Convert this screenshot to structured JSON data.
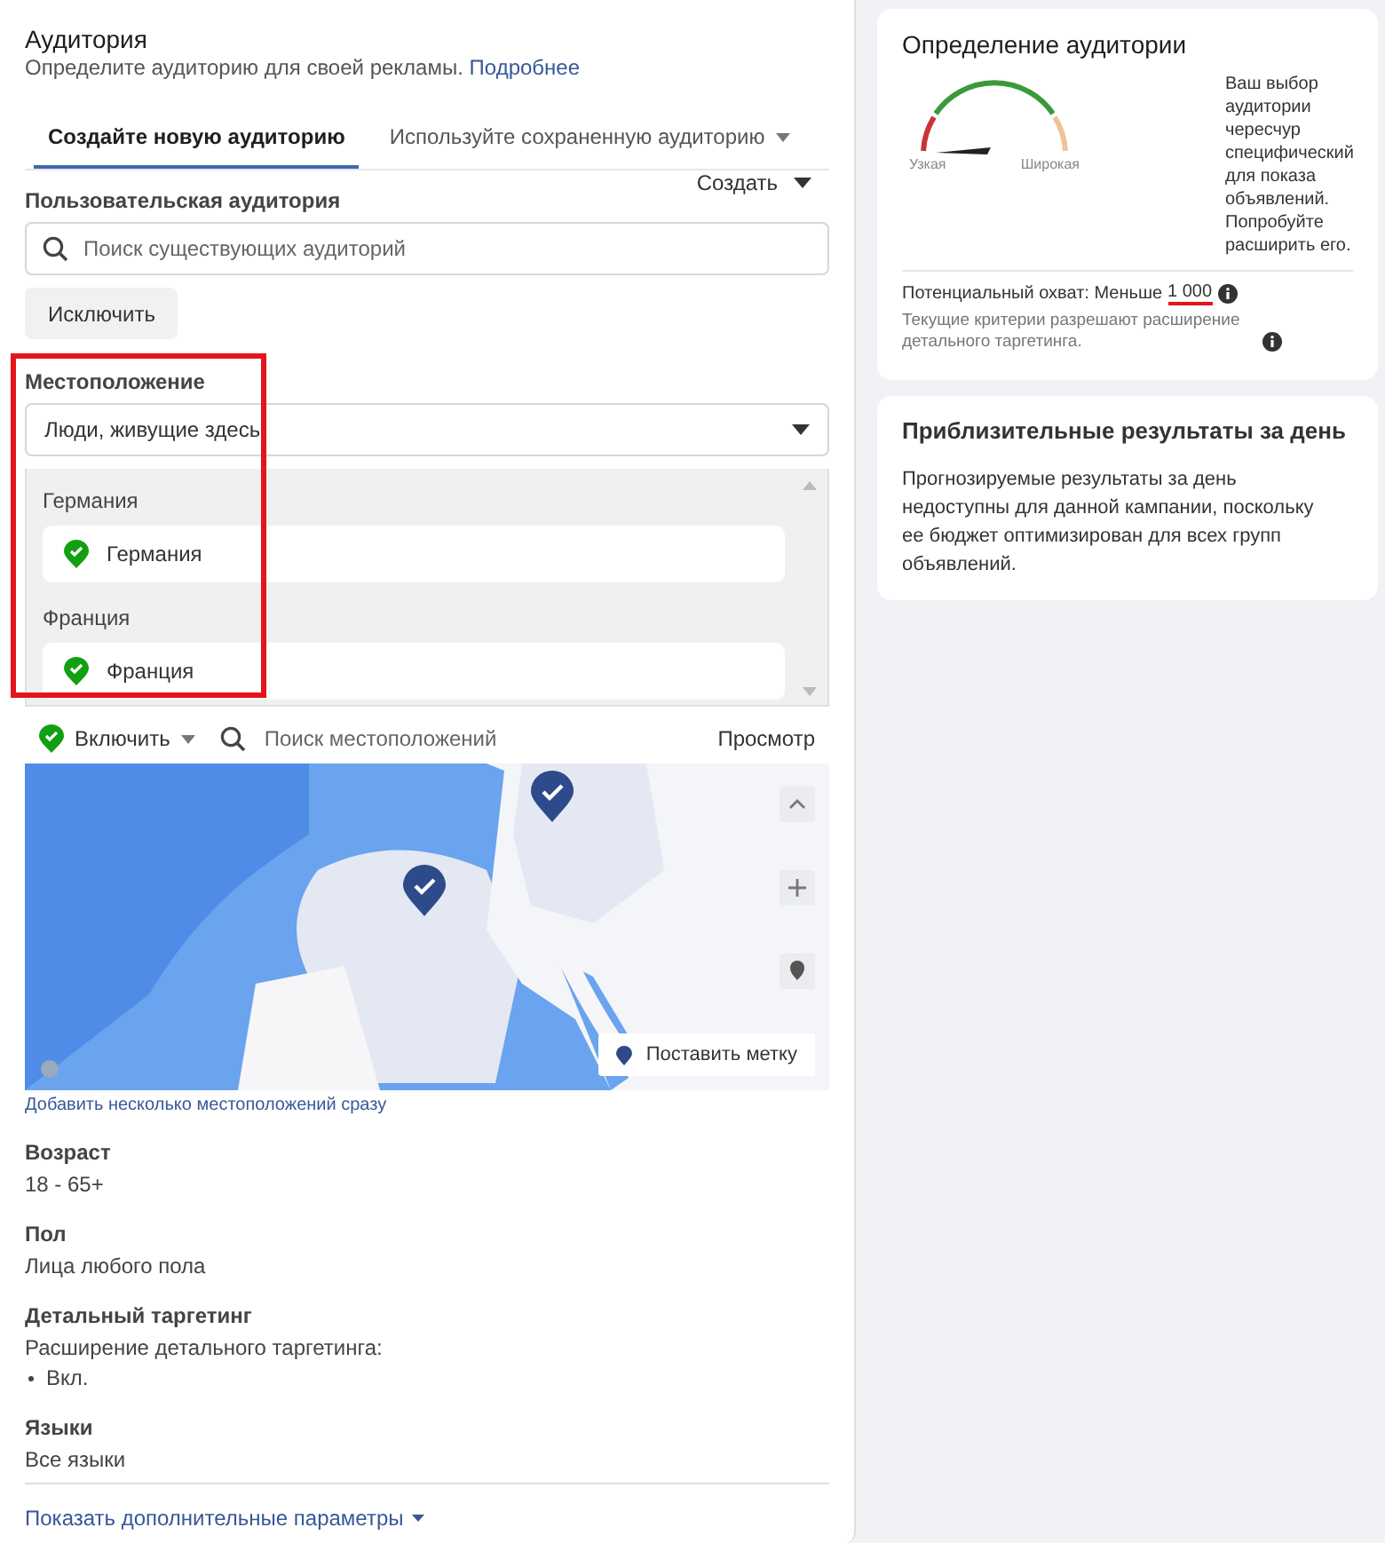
{
  "audience": {
    "title": "Аудитория",
    "subtitle": "Определите аудиторию для своей рекламы.",
    "learn_more": "Подробнее",
    "tabs": [
      {
        "label": "Создайте новую аудиторию",
        "selected": true,
        "dropdown": false
      },
      {
        "label": "Используйте сохраненную аудиторию",
        "selected": false,
        "dropdown": true
      }
    ],
    "custom_audience": {
      "label": "Пользовательская аудитория",
      "create": "Создать",
      "placeholder": "Поиск существующих аудиторий",
      "exclude": "Исключить"
    },
    "location": {
      "label": "Местоположение",
      "highlighted": true,
      "mode": "Люди, живущие здесь",
      "groups": [
        {
          "label": "Германия",
          "items": [
            {
              "name": "Германия",
              "included": true
            }
          ]
        },
        {
          "label": "Франция",
          "items": [
            {
              "name": "Франция",
              "included": true
            }
          ]
        }
      ],
      "include": "Включить",
      "search_placeholder": "Поиск местоположений",
      "browse": "Просмотр",
      "map": {
        "kind": "picture",
        "drop_pin": "Поставить метку"
      },
      "bulk_link": "Добавить несколько местоположений сразу"
    },
    "fields": [
      {
        "kind": "text",
        "label": "Возраст",
        "value": "18 - 65+"
      },
      {
        "kind": "text",
        "label": "Пол",
        "value": "Лица любого пола"
      },
      {
        "kind": "list",
        "label": "Детальный таргетинг",
        "value": "Расширение детального таргетинга:",
        "bullets": [
          "Вкл."
        ]
      },
      {
        "kind": "text",
        "label": "Языки",
        "value": "Все языки"
      }
    ],
    "more_link": "Показать дополнительные параметры"
  },
  "definition": {
    "title": "Определение аудитории",
    "gauge": {
      "level": 0.08,
      "min_label": "Узкая",
      "max_label": "Широкая"
    },
    "message": "Ваш выбор аудитории чересчур специфический для показа объявлений. Попробуйте расширить его.",
    "reach_label": "Потенциальный охват: Меньше",
    "reach_value": "1 000",
    "reach_underlined": true,
    "note": "Текущие критерии разрешают расширение детального таргетинга."
  },
  "daily_results": {
    "title": "Приблизительные результаты за день",
    "text": "Прогнозируемые результаты за день недоступны для данной кампании, поскольку ее бюджет оптимизирован для всех групп объявлений."
  }
}
